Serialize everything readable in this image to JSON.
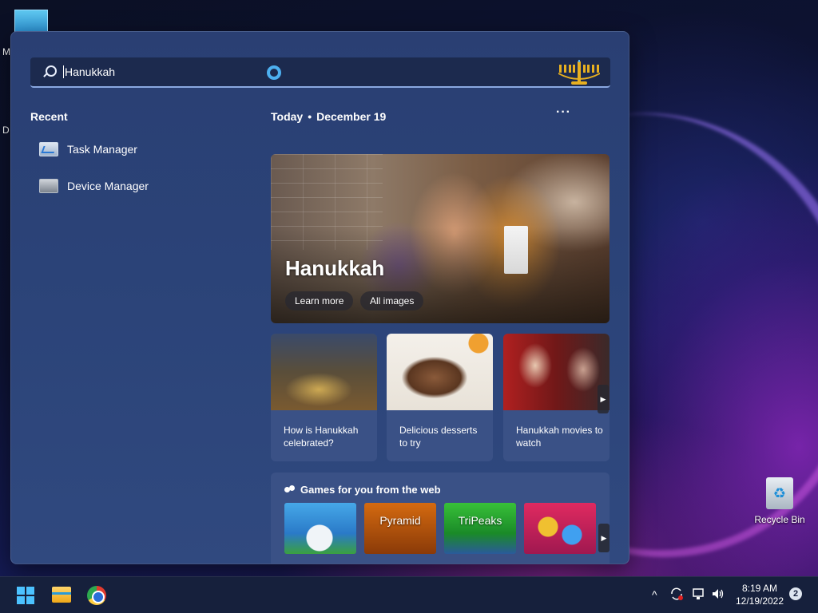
{
  "desktop": {
    "side_letters": [
      "M",
      "D"
    ],
    "recycle_bin_label": "Recycle Bin"
  },
  "start_menu": {
    "search": {
      "value": "Hanukkah",
      "icon": "search-icon"
    },
    "recent": {
      "title": "Recent",
      "items": [
        {
          "label": "Task Manager",
          "icon": "task-manager-icon"
        },
        {
          "label": "Device Manager",
          "icon": "device-manager-icon"
        }
      ]
    },
    "today": {
      "label": "Today",
      "separator": "•",
      "date": "December 19",
      "more": "···"
    },
    "hero": {
      "title": "Hanukkah",
      "buttons": [
        "Learn more",
        "All images"
      ]
    },
    "cards": [
      {
        "caption": "How is Hanukkah celebrated?"
      },
      {
        "caption": "Delicious desserts to try"
      },
      {
        "caption": "Hanukkah movies to watch"
      }
    ],
    "games": {
      "title": "Games for you from the web",
      "items": [
        {
          "name": ""
        },
        {
          "name": "Pyramid"
        },
        {
          "name": "TriPeaks"
        },
        {
          "name": ""
        }
      ]
    },
    "arrow_glyph": "▶"
  },
  "taskbar": {
    "tray_chevron": "^",
    "time": "8:19 AM",
    "date": "12/19/2022",
    "notifications": "2"
  },
  "colors": {
    "accent": "#4cc2ff",
    "start_bg": "#2b4378",
    "card_bg": "#3a5186",
    "taskbar_bg": "#16203c"
  }
}
